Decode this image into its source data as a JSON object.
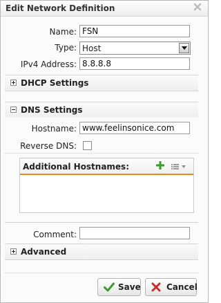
{
  "dialog": {
    "title": "Edit Network Definition"
  },
  "form": {
    "name_label": "Name:",
    "name_value": "FSN",
    "type_label": "Type:",
    "type_value": "Host",
    "ipv4_label": "IPv4 Address:",
    "ipv4_value": "8.8.8.8"
  },
  "dhcp": {
    "title": "DHCP Settings"
  },
  "dns": {
    "title": "DNS Settings",
    "hostname_label": "Hostname:",
    "hostname_value": "www.feelinsonice.com",
    "reverse_label": "Reverse DNS:",
    "additional_title": "Additional Hostnames:"
  },
  "comment": {
    "label": "Comment:",
    "value": ""
  },
  "advanced": {
    "title": "Advanced"
  },
  "buttons": {
    "save": "Save",
    "cancel": "Cancel"
  },
  "colors": {
    "accent_underline": "#e88a1a",
    "add_green": "#3a9b2a",
    "cancel_red": "#cc2b2b"
  }
}
